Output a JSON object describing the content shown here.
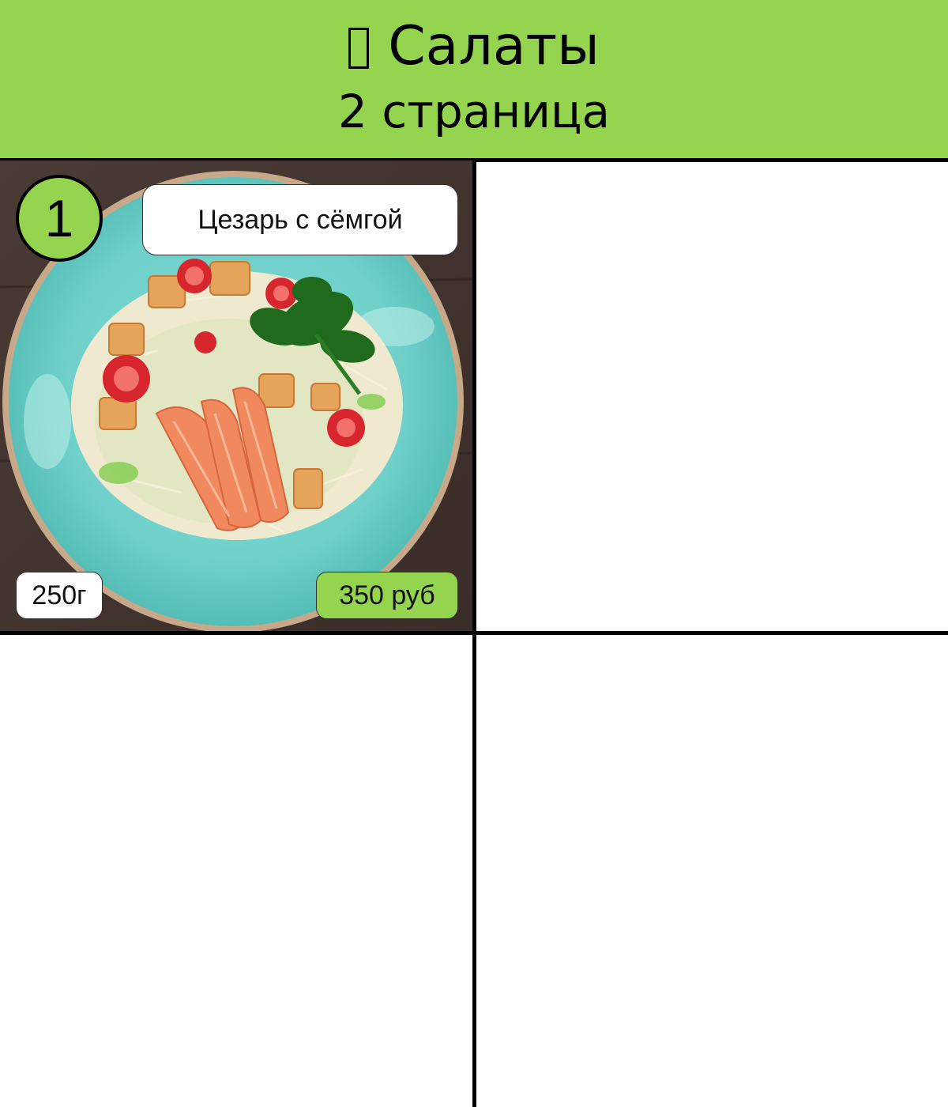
{
  "header": {
    "title": "Салаты",
    "subtitle": "2 страница",
    "background_color": "#94d44e"
  },
  "menu_items": [
    {
      "number": "1",
      "name": "Цезарь с сёмгой",
      "weight": "250г",
      "price": "350 руб",
      "photo_icon": "caesar-salmon-salad-photo"
    }
  ],
  "colors": {
    "accent": "#94d44e",
    "grid_lines": "#000000"
  }
}
